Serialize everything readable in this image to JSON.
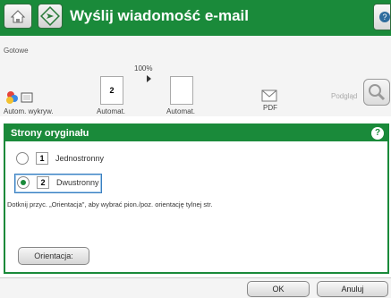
{
  "header": {
    "title": "Wyślij wiadomość e-mail",
    "home_icon": "home-icon",
    "app_icon": "email-icon",
    "help_icon": "help-icon"
  },
  "status_text": "Gotowe",
  "options": {
    "zoom": "100%",
    "items": [
      {
        "label": "Autom. wykryw.",
        "icon": "color-detect-icon"
      },
      {
        "label": "Automat.",
        "icon": "sides-icon"
      },
      {
        "label": "Automat.",
        "icon": "page-icon"
      },
      {
        "label": "PDF",
        "icon": "file-type-icon"
      }
    ],
    "preview_label": "Podgląd"
  },
  "panel": {
    "title": "Strony oryginału",
    "radios": [
      {
        "number": "1",
        "label": "Jednostronny",
        "selected": false
      },
      {
        "number": "2",
        "label": "Dwustronny",
        "selected": true
      }
    ],
    "info": "Dotknij przyc. „Orientacja\", aby wybrać pion./poz. orientację tylnej str.",
    "orientation_button": "Orientacja:"
  },
  "footer": {
    "ok_label": "OK",
    "cancel_label": "Anuluj"
  },
  "colors": {
    "accent": "#1a8a3a",
    "selection": "#3a7fc0"
  }
}
